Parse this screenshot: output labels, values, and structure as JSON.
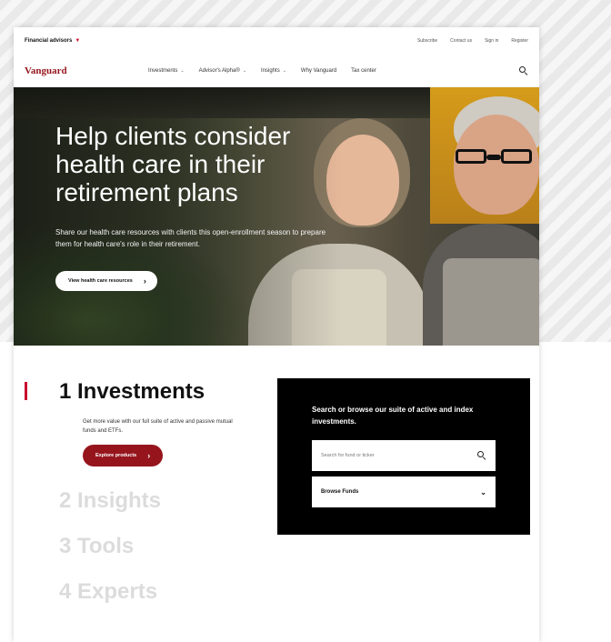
{
  "utility_bar": {
    "audience_label": "Financial advisors",
    "links": [
      "Subscribe",
      "Contact us",
      "Sign in",
      "Register"
    ]
  },
  "nav": {
    "logo": "Vanguard",
    "items": [
      {
        "label": "Investments",
        "dropdown": true
      },
      {
        "label": "Advisor's Alpha®",
        "dropdown": true
      },
      {
        "label": "Insights",
        "dropdown": true
      },
      {
        "label": "Why Vanguard",
        "dropdown": false
      },
      {
        "label": "Tax center",
        "dropdown": false
      }
    ]
  },
  "hero": {
    "title": "Help clients consider health care in their retirement plans",
    "subtitle": "Share our health care resources with clients this open-enrollment season to prepare them for health care's role in their retirement.",
    "button_label": "View health care resources"
  },
  "steps": {
    "active": {
      "label": "1 Investments",
      "description": "Get more value with our full suite of active and passive mutual funds and ETFs.",
      "button_label": "Explore products"
    },
    "inactive": [
      "2 Insights",
      "3 Tools",
      "4 Experts"
    ]
  },
  "search_panel": {
    "heading": "Search or browse our suite of active and index investments.",
    "placeholder": "Search for fund or ticker",
    "browse_label": "Browse Funds"
  },
  "colors": {
    "brand_red": "#96151d",
    "accent_red": "#c8102e",
    "panel_bg": "#000000"
  }
}
